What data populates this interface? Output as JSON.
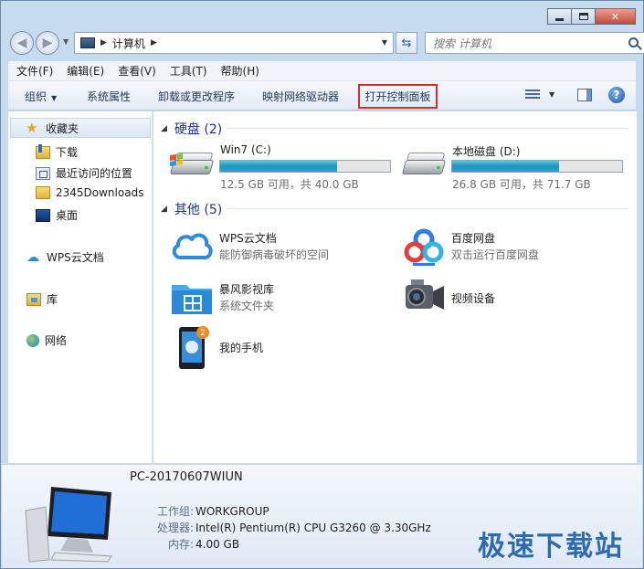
{
  "window": {
    "address": {
      "location": "计算机"
    },
    "search": {
      "placeholder": "搜索 计算机"
    }
  },
  "menubar": [
    "文件(F)",
    "编辑(E)",
    "查看(V)",
    "工具(T)",
    "帮助(H)"
  ],
  "commandbar": {
    "organize": "组织",
    "system_properties": "系统属性",
    "uninstall": "卸载或更改程序",
    "map_drive": "映射网络驱动器",
    "control_panel": "打开控制面板"
  },
  "sidebar": {
    "favorites": "收藏夹",
    "items": [
      "下载",
      "最近访问的位置",
      "2345Downloads",
      "桌面"
    ],
    "wps": "WPS云文档",
    "libraries": "库",
    "network": "网络"
  },
  "groups": {
    "hard_disks": "硬盘 (2)",
    "others": "其他 (5)"
  },
  "drives": [
    {
      "name": "Win7 (C:)",
      "free": "12.5 GB 可用，共 40.0 GB",
      "used_fraction": 0.69
    },
    {
      "name": "本地磁盘 (D:)",
      "free": "26.8 GB 可用，共 71.7 GB",
      "used_fraction": 0.63
    }
  ],
  "others": [
    {
      "name": "WPS云文档",
      "sub": "能防御病毒破坏的空间",
      "icon": "wps-cloud-icon"
    },
    {
      "name": "百度网盘",
      "sub": "双击运行百度网盘",
      "icon": "baidu-netdisk-icon"
    },
    {
      "name": "暴风影视库",
      "sub": "系统文件夹",
      "icon": "baofeng-folder-icon"
    },
    {
      "name": "视频设备",
      "sub": "",
      "icon": "video-camera-icon"
    },
    {
      "name": "我的手机",
      "sub": "",
      "icon": "phone-icon",
      "badge": "2"
    }
  ],
  "details": {
    "pc_name": "PC-20170607WIUN",
    "workgroup_label": "工作组:",
    "workgroup": "WORKGROUP",
    "cpu_label": "处理器:",
    "cpu": "Intel(R) Pentium(R) CPU G3260 @ 3.30GHz",
    "memory_label": "内存:",
    "memory": "4.00 GB"
  },
  "watermark": "极速下载站",
  "colors": {
    "highlight_box": "#e02b2b",
    "drive_fill": "#27a3cf",
    "link_blue": "#1e3287"
  }
}
